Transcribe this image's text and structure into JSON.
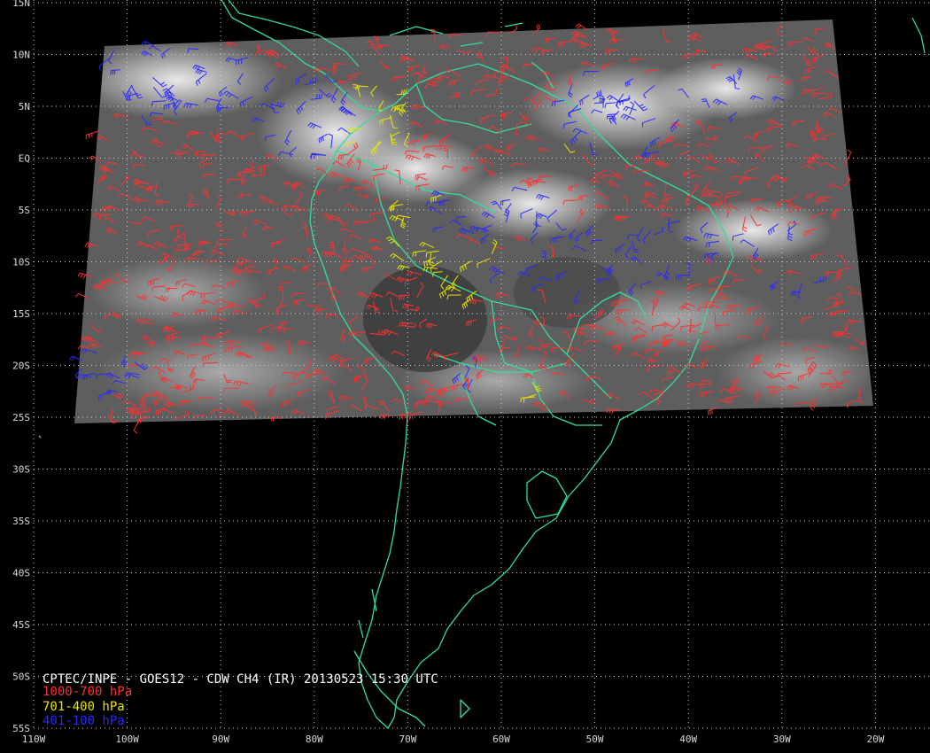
{
  "caption": {
    "title": "CPTEC/INPE - GOES12 - CDW CH4 (IR) 20130523 15:30 UTC"
  },
  "legend": [
    {
      "label": "1000-700 hPa",
      "color": "#ff3030"
    },
    {
      "label": "701-400 hPa",
      "color": "#e6e600"
    },
    {
      "label": "401-100 hPa",
      "color": "#2a2aff"
    }
  ],
  "colors": {
    "background": "#000000",
    "coastline": "#33dd99",
    "grid": "#cfcfcf",
    "label": "#d8d8d8",
    "title": "#ffffff"
  },
  "lat_labels": [
    "15N",
    "10N",
    "5N",
    "EQ",
    "5S",
    "10S",
    "15S",
    "20S",
    "25S",
    "30S",
    "35S",
    "40S",
    "45S",
    "50S",
    "55S"
  ],
  "lon_labels": [
    "110W",
    "100W",
    "90W",
    "80W",
    "70W",
    "60W",
    "50W",
    "40W",
    "30W",
    "20W"
  ]
}
